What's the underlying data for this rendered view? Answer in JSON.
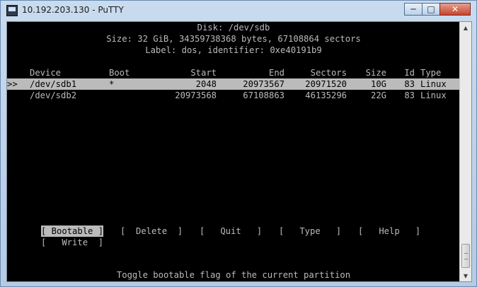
{
  "window": {
    "title": "10.192.203.130 - PuTTY",
    "controls": {
      "minimize": "─",
      "maximize": "□",
      "close": "✕"
    }
  },
  "disk": {
    "header": "Disk: /dev/sdb",
    "size_line": "Size: 32 GiB, 34359738368 bytes, 67108864 sectors",
    "label_line": "Label: dos, identifier: 0xe40191b9"
  },
  "table": {
    "headers": {
      "device": "Device",
      "boot": "Boot",
      "start": "Start",
      "end": "End",
      "sectors": "Sectors",
      "size": "Size",
      "id": "Id",
      "type": "Type"
    },
    "rows": [
      {
        "marker": ">>",
        "device": "/dev/sdb1",
        "boot": "*",
        "start": "2048",
        "end": "20973567",
        "sectors": "20971520",
        "size": "10G",
        "id": "83",
        "type": "Linux"
      },
      {
        "marker": "",
        "device": "/dev/sdb2",
        "boot": "",
        "start": "20973568",
        "end": "67108863",
        "sectors": "46135296",
        "size": "22G",
        "id": "83",
        "type": "Linux"
      }
    ]
  },
  "menu": {
    "bootable": "[ Bootable ]",
    "delete": "[  Delete  ]",
    "quit": "[   Quit   ]",
    "type": "[   Type   ]",
    "help": "[   Help   ]",
    "write": "[   Write  ]"
  },
  "status": "Toggle bootable flag of the current partition",
  "scrollbar": {
    "up": "▲",
    "down": "▼"
  }
}
